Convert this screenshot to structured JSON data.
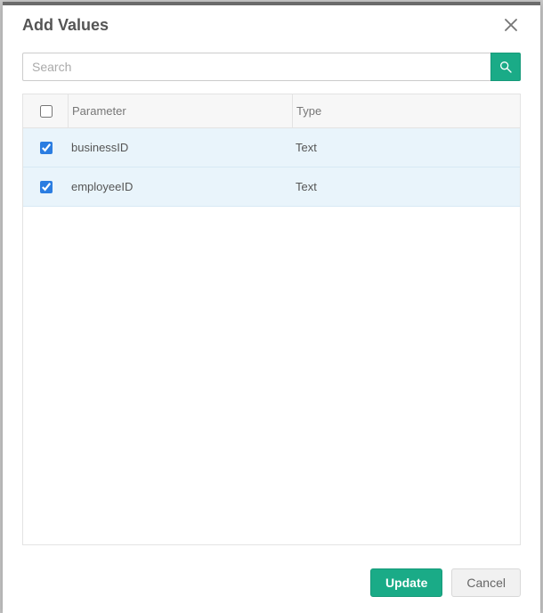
{
  "modal": {
    "title": "Add Values"
  },
  "search": {
    "placeholder": "Search",
    "value": ""
  },
  "table": {
    "headers": {
      "parameter": "Parameter",
      "type": "Type"
    },
    "rows": [
      {
        "selected": true,
        "parameter": "businessID",
        "type": "Text"
      },
      {
        "selected": true,
        "parameter": "employeeID",
        "type": "Text"
      }
    ]
  },
  "buttons": {
    "update": "Update",
    "cancel": "Cancel"
  },
  "colors": {
    "accent": "#1aab87",
    "checkbox": "#2b7de1",
    "row_selected_bg": "#e9f4fb"
  }
}
